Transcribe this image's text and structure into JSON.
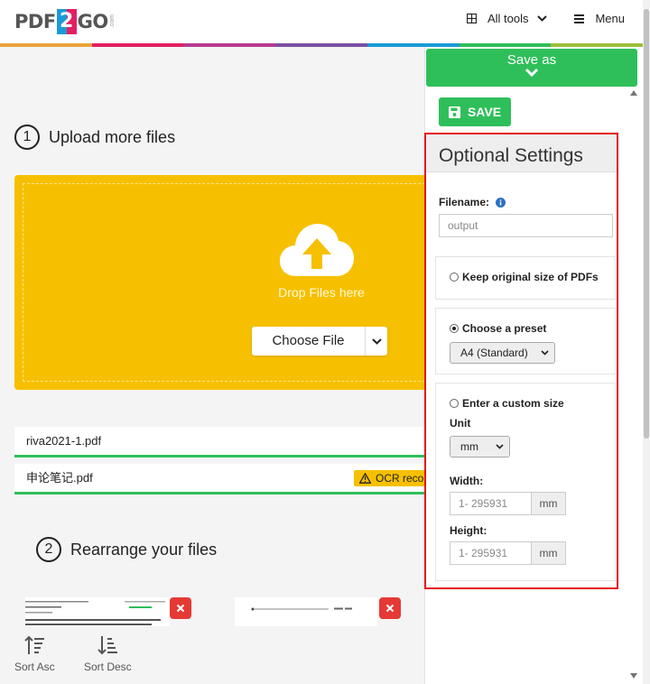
{
  "header": {
    "logo": {
      "pdf": "PDF",
      "two": "2",
      "go": "GO",
      "com": ".com"
    },
    "all_tools": "All tools",
    "menu": "Menu"
  },
  "stripe_colors": [
    "#e8a33a",
    "#e31e63",
    "#b83b8f",
    "#7b4fa0",
    "#1a9bd7",
    "#2fbf5a",
    "#9dc03b"
  ],
  "step1": {
    "num": "1",
    "title": "Upload more files"
  },
  "dropzone": {
    "text": "Drop Files here",
    "choose_label": "Choose File"
  },
  "files": [
    {
      "name": "riva2021-1.pdf",
      "badge": ""
    },
    {
      "name": "申论笔记.pdf",
      "badge": "OCR recor"
    }
  ],
  "step2": {
    "num": "2",
    "title": "Rearrange your files"
  },
  "sort": {
    "asc": "Sort Asc",
    "desc": "Sort Desc"
  },
  "panel": {
    "save_as": "Save as",
    "save_button": "SAVE",
    "optional_settings": "Optional Settings",
    "filename_label": "Filename:",
    "filename_placeholder": "output",
    "keep_original": "Keep original size of PDFs",
    "choose_preset": "Choose a preset",
    "preset_value": "A4 (Standard)",
    "custom_size": "Enter a custom size",
    "unit_label": "Unit",
    "unit_value": "mm",
    "width_label": "Width:",
    "width_placeholder": "1- 295931",
    "width_unit": "mm",
    "height_label": "Height:",
    "height_placeholder": "1- 295931",
    "height_unit": "mm"
  },
  "colors": {
    "green": "#2fbf5a",
    "yellow": "#f6c000",
    "red": "#e53935",
    "highlight": "#e3141b"
  }
}
